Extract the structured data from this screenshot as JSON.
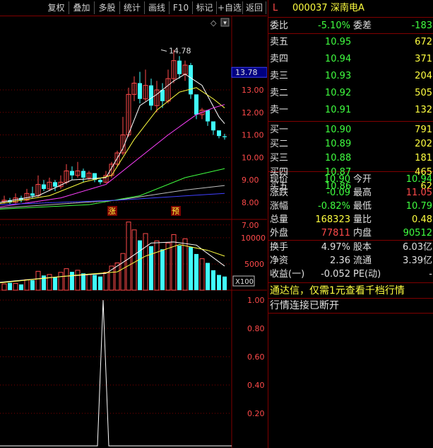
{
  "toolbar": {
    "items": [
      "复权",
      "叠加",
      "多股",
      "统计",
      "画线",
      "F10",
      "标记",
      "+自选",
      "返回"
    ]
  },
  "stock": {
    "flag": "L",
    "code": "000037",
    "name": "深南电A"
  },
  "header_icons": {
    "diamond": "◇",
    "dropdown": "▾"
  },
  "chart": {
    "high_label": "14.78",
    "price_tag": "13.78",
    "price_axis": [
      "13.00",
      "12.00",
      "11.00",
      "10.00",
      "9.00",
      "8.00",
      "7.00"
    ],
    "badges": [
      "涨",
      "预"
    ],
    "vol_axis": [
      "10000",
      "5000"
    ],
    "vol_unit": "X100",
    "ind_axis": [
      "1.00",
      "0.80",
      "0.60",
      "0.40",
      "0.20"
    ],
    "colors": {
      "up": "#ff4a4a",
      "down": "#40ffff",
      "ma5": "#ffffff",
      "ma10": "#ffff40",
      "ma20": "#ff40ff",
      "ma60": "#40ff40",
      "ma120": "#c0c0c0",
      "ma250": "#4040ff",
      "grid": "#800000"
    }
  },
  "quote": {
    "weibi": {
      "label": "委比",
      "value": "-5.10%",
      "label2": "委差",
      "value2": "-183"
    },
    "sell": [
      {
        "label": "卖五",
        "price": "10.95",
        "vol": "672"
      },
      {
        "label": "卖四",
        "price": "10.94",
        "vol": "371"
      },
      {
        "label": "卖三",
        "price": "10.93",
        "vol": "204"
      },
      {
        "label": "卖二",
        "price": "10.92",
        "vol": "505"
      },
      {
        "label": "卖一",
        "price": "10.91",
        "vol": "132"
      }
    ],
    "buy": [
      {
        "label": "买一",
        "price": "10.90",
        "vol": "791"
      },
      {
        "label": "买二",
        "price": "10.89",
        "vol": "202"
      },
      {
        "label": "买三",
        "price": "10.88",
        "vol": "181"
      },
      {
        "label": "买四",
        "price": "10.87",
        "vol": "465"
      },
      {
        "label": "买五",
        "price": "10.86",
        "vol": "62"
      }
    ],
    "stats": [
      {
        "l1": "现价",
        "v1": "10.90",
        "c1": "green",
        "l2": "今开",
        "v2": "10.94",
        "c2": "green"
      },
      {
        "l1": "涨跌",
        "v1": "-0.09",
        "c1": "green",
        "l2": "最高",
        "v2": "11.05",
        "c2": "red"
      },
      {
        "l1": "涨幅",
        "v1": "-0.82%",
        "c1": "green",
        "l2": "最低",
        "v2": "10.79",
        "c2": "green"
      },
      {
        "l1": "总量",
        "v1": "168323",
        "c1": "yellow",
        "l2": "量比",
        "v2": "0.48",
        "c2": "yellow"
      },
      {
        "l1": "外盘",
        "v1": "77811",
        "c1": "red",
        "l2": "内盘",
        "v2": "90512",
        "c2": "green"
      }
    ],
    "fin": [
      {
        "l1": "换手",
        "v1": "4.97%",
        "l2": "股本",
        "v2": "6.03亿"
      },
      {
        "l1": "净资",
        "v1": "2.36",
        "l2": "流通",
        "v2": "3.39亿"
      },
      {
        "l1": "收益(一)",
        "v1": "-0.052",
        "l2": "PE(动)",
        "v2": "-"
      }
    ],
    "notice": "通达信，仅需1元查看千档行情",
    "status": "行情连接已断开"
  }
}
